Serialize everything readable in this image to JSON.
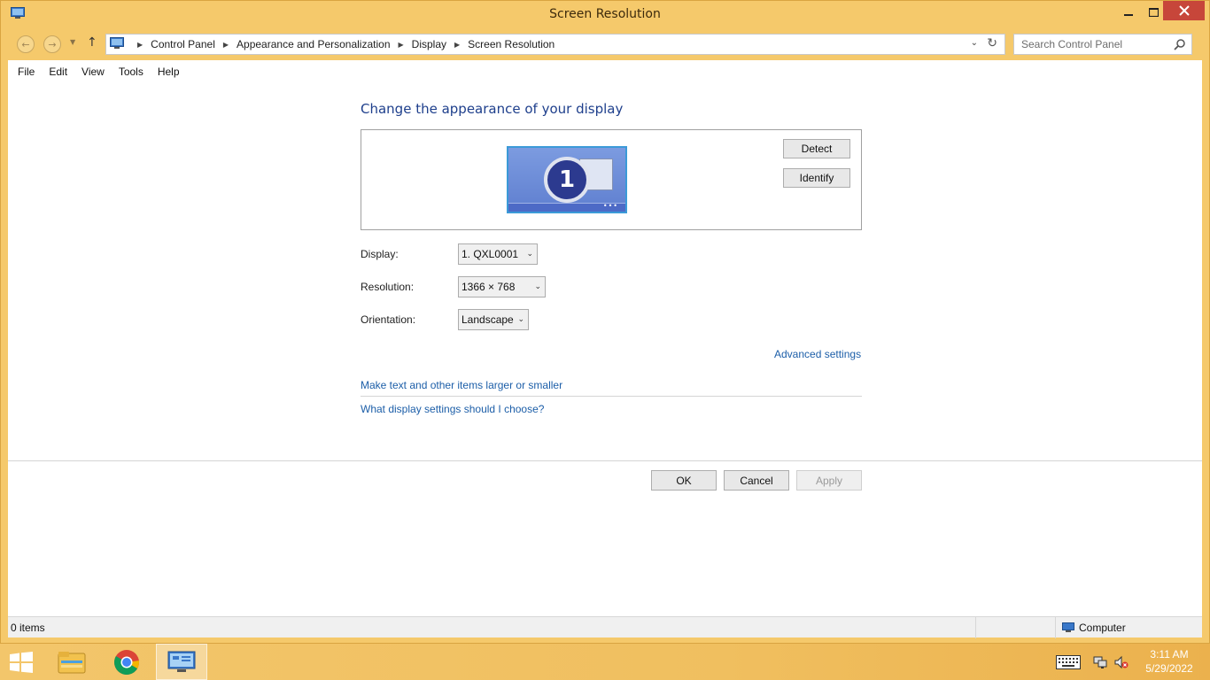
{
  "window": {
    "title": "Screen Resolution"
  },
  "address_bar": {
    "breadcrumbs": [
      "Control Panel",
      "Appearance and Personalization",
      "Display",
      "Screen Resolution"
    ]
  },
  "search": {
    "placeholder": "Search Control Panel"
  },
  "menu": {
    "items": [
      "File",
      "Edit",
      "View",
      "Tools",
      "Help"
    ]
  },
  "main": {
    "heading": "Change the appearance of your display",
    "monitor_number": "1",
    "detect_label": "Detect",
    "identify_label": "Identify",
    "display_label": "Display:",
    "display_value": "1. QXL0001",
    "resolution_label": "Resolution:",
    "resolution_value": "1366 × 768",
    "orientation_label": "Orientation:",
    "orientation_value": "Landscape",
    "advanced_link": "Advanced settings",
    "text_size_link": "Make text and other items larger or smaller",
    "help_link": "What display settings should I choose?",
    "ok_label": "OK",
    "cancel_label": "Cancel",
    "apply_label": "Apply"
  },
  "status_bar": {
    "items_count": "0 items",
    "location": "Computer"
  },
  "taskbar": {
    "time": "3:11 AM",
    "date": "5/29/2022"
  },
  "colors": {
    "window_frame": "#f5c96b",
    "heading": "#1e3f8c",
    "link": "#1c5ea8",
    "close_button": "#c7463a"
  },
  "icons": [
    "control-panel-icon",
    "back-arrow-icon",
    "forward-arrow-icon",
    "up-arrow-icon",
    "refresh-icon",
    "search-icon",
    "windows-logo-icon",
    "file-explorer-icon",
    "chrome-icon",
    "keyboard-icon",
    "network-icon",
    "volume-muted-icon",
    "computer-icon"
  ]
}
